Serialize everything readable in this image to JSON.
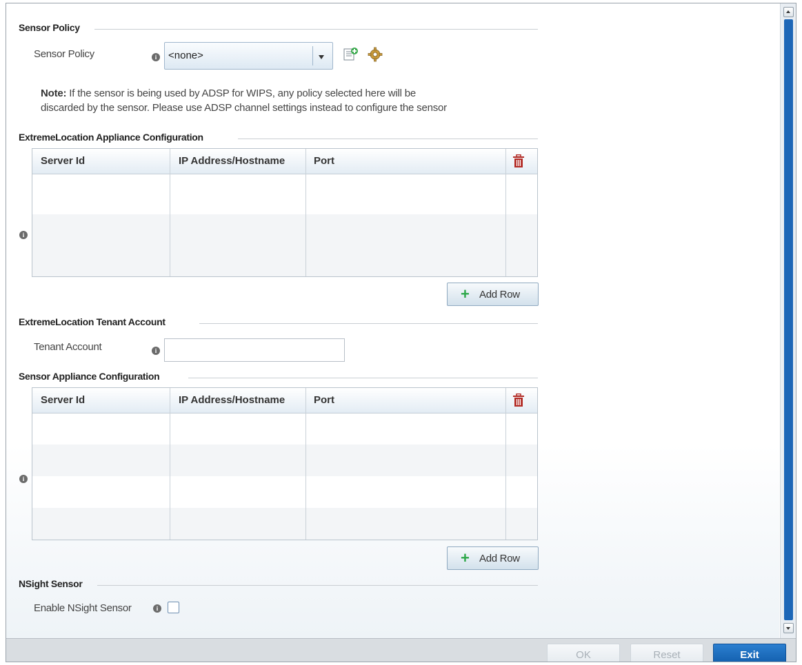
{
  "sections": {
    "sensor_policy": "Sensor Policy",
    "extreme_location_config": "ExtremeLocation Appliance Configuration",
    "tenant_account": "ExtremeLocation Tenant Account",
    "sensor_appliance_config": "Sensor Appliance Configuration",
    "nsight": "NSight Sensor"
  },
  "sensor_policy": {
    "label": "Sensor Policy",
    "selected": "<none>"
  },
  "note": {
    "bold": "Note:",
    "line1": " If the sensor is being used by ADSP for WIPS, any policy selected here will be",
    "line2": "discarded by the sensor. Please use ADSP channel settings instead to configure the sensor"
  },
  "table_columns": {
    "server_id": "Server Id",
    "ip": "IP Address/Hostname",
    "port": "Port"
  },
  "add_row_label": "Add Row",
  "tenant": {
    "label": "Tenant Account",
    "value": ""
  },
  "nsight": {
    "label": "Enable NSight Sensor",
    "checked": false
  },
  "footer": {
    "ok": "OK",
    "reset": "Reset",
    "exit": "Exit"
  },
  "colors": {
    "accent": "#0f5aa8",
    "add_plus": "#2ea84a",
    "trash": "#b22a24",
    "scroll_thumb": "#1d67b7"
  }
}
